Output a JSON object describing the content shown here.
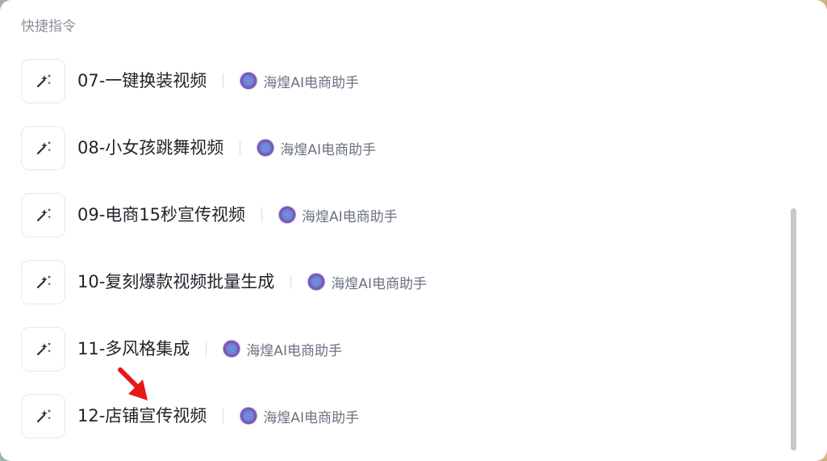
{
  "panel": {
    "title": "快捷指令"
  },
  "items": [
    {
      "name": "07-一键换装视频",
      "author": "海煌AI电商助手",
      "icon": "sparkle-magic-icon"
    },
    {
      "name": "08-小女孩跳舞视频",
      "author": "海煌AI电商助手",
      "icon": "sparkle-magic-icon"
    },
    {
      "name": "09-电商15秒宣传视频",
      "author": "海煌AI电商助手",
      "icon": "sparkle-magic-icon"
    },
    {
      "name": "10-复刻爆款视频批量生成",
      "author": "海煌AI电商助手",
      "icon": "sparkle-magic-icon"
    },
    {
      "name": "11-多风格集成",
      "author": "海煌AI电商助手",
      "icon": "sparkle-magic-icon"
    },
    {
      "name": "12-店铺宣传视频",
      "author": "海煌AI电商助手",
      "icon": "sparkle-magic-icon"
    }
  ],
  "colors": {
    "annotation_arrow": "#e8171a",
    "icon_stroke": "#2b2f36"
  }
}
